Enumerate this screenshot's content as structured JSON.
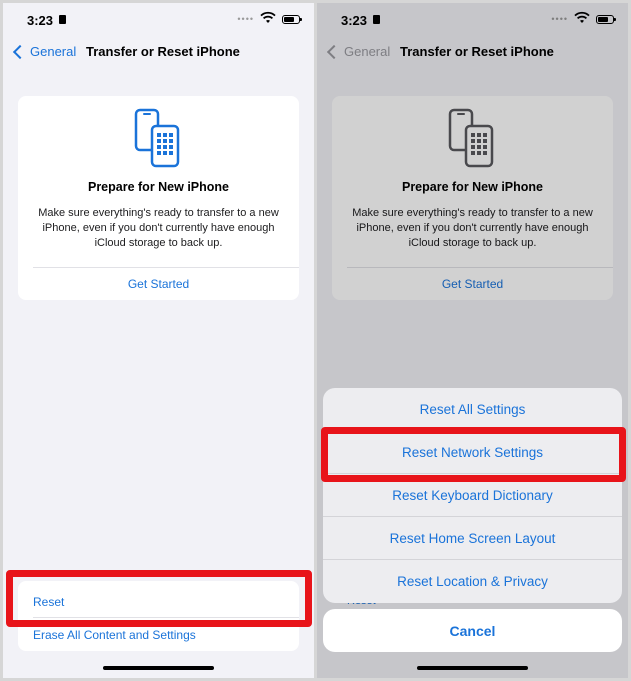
{
  "status": {
    "time": "3:23"
  },
  "nav": {
    "back_label": "General",
    "title": "Transfer or Reset iPhone"
  },
  "card": {
    "heading": "Prepare for New iPhone",
    "description": "Make sure everything's ready to transfer to a new iPhone, even if you don't currently have enough iCloud storage to back up.",
    "cta": "Get Started"
  },
  "list": {
    "items": [
      {
        "label": "Reset"
      },
      {
        "label": "Erase All Content and Settings"
      }
    ]
  },
  "action_sheet": {
    "options": [
      {
        "label": "Reset All Settings"
      },
      {
        "label": "Reset Network Settings"
      },
      {
        "label": "Reset Keyboard Dictionary"
      },
      {
        "label": "Reset Home Screen Layout"
      },
      {
        "label": "Reset Location & Privacy"
      }
    ],
    "cancel": "Cancel"
  },
  "colors": {
    "accent": "#1a73d9",
    "highlight": "#e8141a"
  }
}
